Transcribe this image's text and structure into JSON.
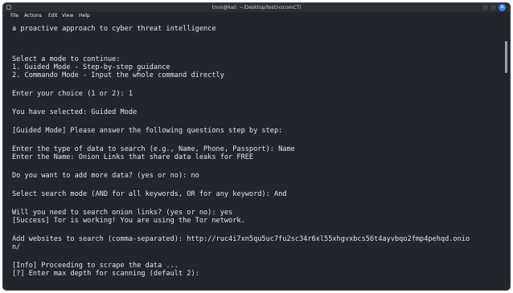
{
  "window": {
    "title": "tnvn@kali: ~/Desktop/test/vscomCTI"
  },
  "menu": {
    "file": "File",
    "actions": "Actions",
    "edit": "Edit",
    "view": "View",
    "help": "Help"
  },
  "icons": {
    "close_glyph": "✕"
  },
  "terminal": {
    "lines": [
      "a proactive approach to cyber threat intelligence",
      "",
      "",
      "Select a mode to continue:",
      "1. Guided Mode - Step-by-step guidance",
      "2. Commando Mode - Input the whole command directly",
      "",
      "Enter your choice (1 or 2): 1",
      "",
      "You have selected: Guided Mode",
      "",
      "[Guided Mode] Please answer the following questions step by step:",
      "",
      "Enter the type of data to search (e.g., Name, Phone, Passport): Name",
      "Enter the Name: Onion Links that share data leaks for FREE",
      "",
      "Do you want to add more data? (yes or no): no",
      "",
      "Select search mode (AND for all keywords, OR for any keyword): And",
      "",
      "Will you need to search onion links? (yes or no): yes",
      "[Success] Tor is working! You are using the Tor network.",
      "",
      "Add websites to search (comma-separated): http://ruc4i7xn5qu5uc7fu2sc34r6xl55xhgvxbcs56t4ayvbqo2fmp4pehqd.onio",
      "n/",
      "",
      "[Info] Proceeding to scrape the data ...",
      "[?] Enter max depth for scanning (default 2):"
    ]
  },
  "colors": {
    "terminal_bg": "#21252c",
    "titlebar_bg": "#2b3038",
    "text": "#e3e6ea",
    "close_button": "#3d7ef0"
  }
}
